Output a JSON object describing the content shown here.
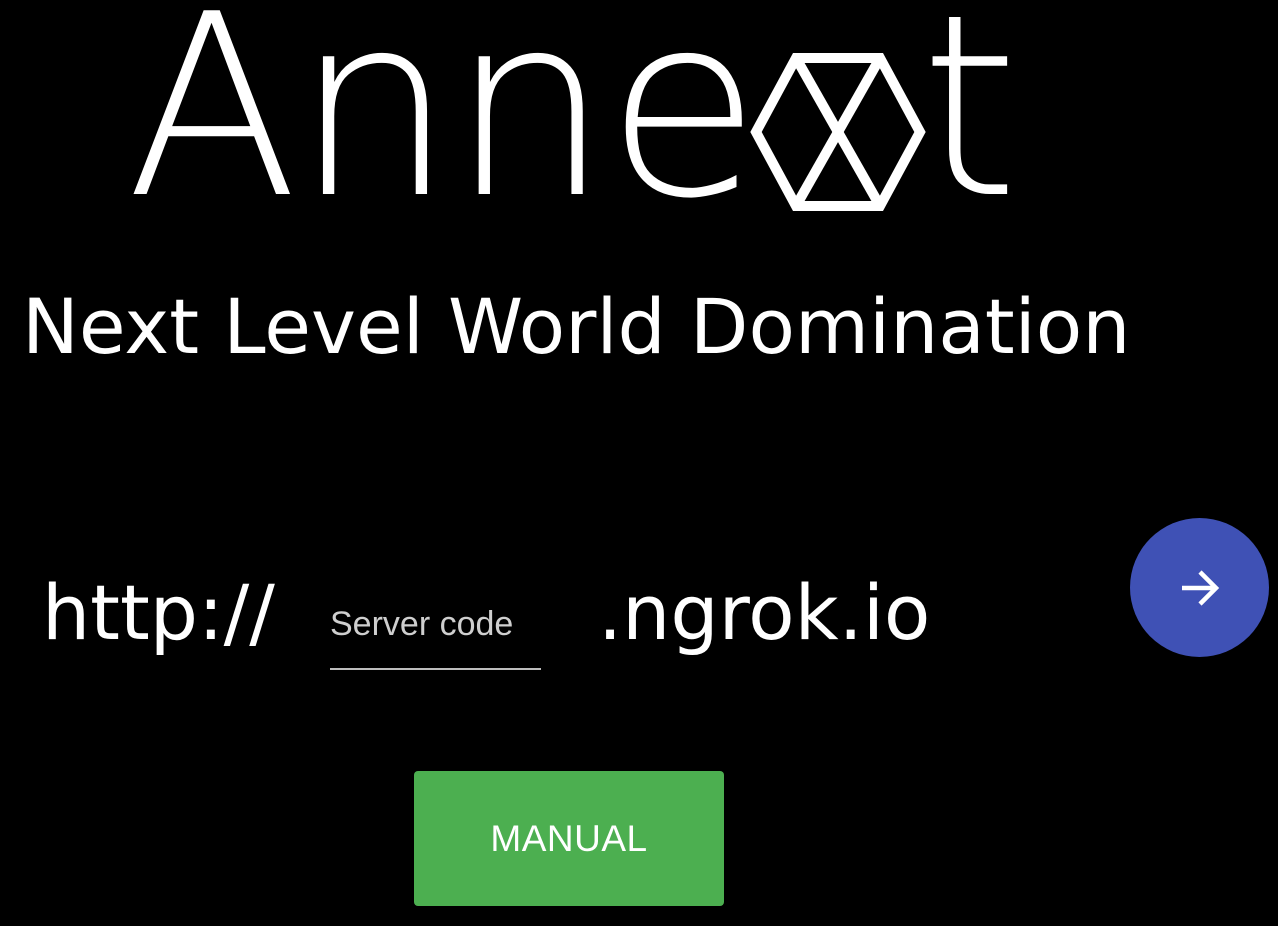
{
  "logo": {
    "text_start": "Anne",
    "text_end": "t",
    "icon": "hexagon-x-icon"
  },
  "tagline": "Next Level World Domination",
  "server": {
    "prefix": "http://",
    "placeholder": "Server code",
    "value": "",
    "suffix": ".ngrok.io"
  },
  "go_button": {
    "icon": "arrow-right-icon",
    "color": "#3f51b5"
  },
  "manual_button": {
    "label": "MANUAL",
    "color": "#4caf50"
  },
  "colors": {
    "background": "#000000",
    "text": "#ffffff"
  }
}
